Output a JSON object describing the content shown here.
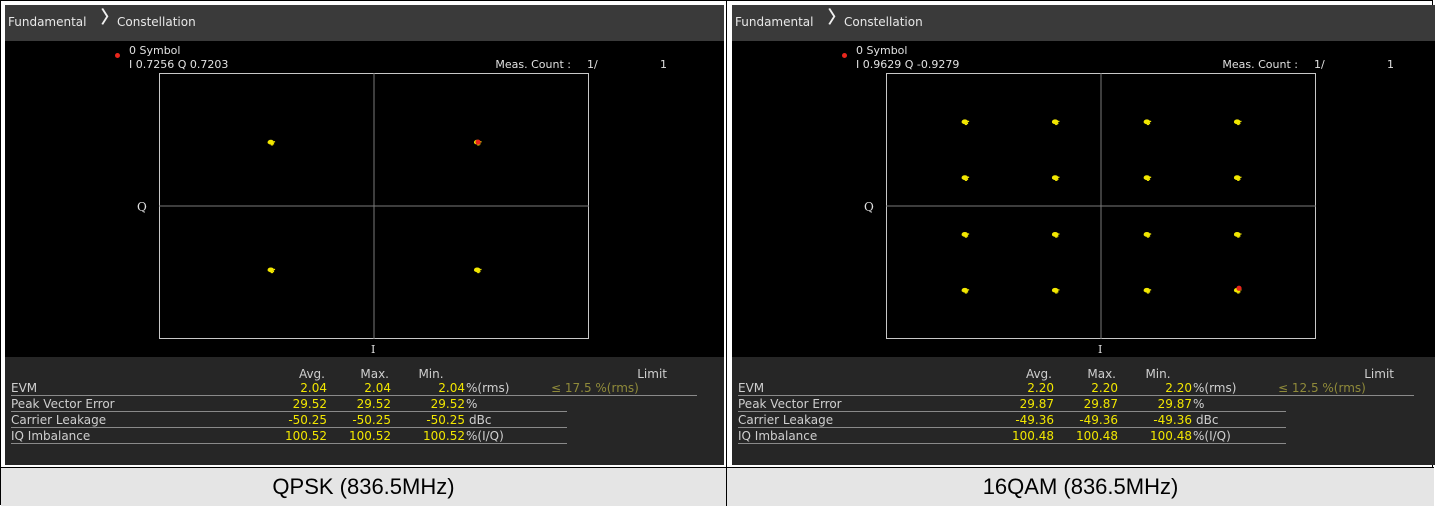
{
  "panels": [
    {
      "breadcrumb": [
        "Fundamental",
        "Constellation"
      ],
      "marker": {
        "title": "0 Symbol",
        "iq": "I 0.7256 Q 0.7203"
      },
      "meas_count": {
        "label": "Meas. Count :",
        "value": "1/",
        "total": "1"
      },
      "axes": {
        "x": "I",
        "y": "Q"
      },
      "modulation": "QPSK",
      "constellation": {
        "symbols": [
          [
            -0.72,
            0.72
          ],
          [
            0.72,
            0.72
          ],
          [
            -0.72,
            -0.72
          ],
          [
            0.72,
            -0.72
          ]
        ],
        "marker_symbol": [
          0.7256,
          0.7203
        ],
        "range": [
          -1.5,
          1.5
        ]
      },
      "results": {
        "headers": {
          "avg": "Avg.",
          "max": "Max.",
          "min": "Min.",
          "limit": "Limit"
        },
        "rows": [
          {
            "label": "EVM",
            "avg": "2.04",
            "max": "2.04",
            "min": "2.04",
            "unit": "%(rms)",
            "limit": "≤ 17.5 %(rms)"
          },
          {
            "label": "Peak Vector Error",
            "avg": "29.52",
            "max": "29.52",
            "min": "29.52",
            "unit": "%",
            "limit": ""
          },
          {
            "label": "Carrier Leakage",
            "avg": "-50.25",
            "max": "-50.25",
            "min": "-50.25",
            "unit": "dBc",
            "limit": ""
          },
          {
            "label": "IQ Imbalance",
            "avg": "100.52",
            "max": "100.52",
            "min": "100.52",
            "unit": "%(I/Q)",
            "limit": ""
          }
        ]
      },
      "caption": "QPSK (836.5MHz)"
    },
    {
      "breadcrumb": [
        "Fundamental",
        "Constellation"
      ],
      "marker": {
        "title": "0 Symbol",
        "iq": "I 0.9629 Q -0.9279"
      },
      "meas_count": {
        "label": "Meas. Count :",
        "value": "1/",
        "total": "1"
      },
      "axes": {
        "x": "I",
        "y": "Q"
      },
      "modulation": "16QAM",
      "constellation": {
        "symbols": [
          [
            -0.95,
            0.95
          ],
          [
            -0.32,
            0.95
          ],
          [
            0.32,
            0.95
          ],
          [
            0.95,
            0.95
          ],
          [
            -0.95,
            0.32
          ],
          [
            -0.32,
            0.32
          ],
          [
            0.32,
            0.32
          ],
          [
            0.95,
            0.32
          ],
          [
            -0.95,
            -0.32
          ],
          [
            -0.32,
            -0.32
          ],
          [
            0.32,
            -0.32
          ],
          [
            0.95,
            -0.32
          ],
          [
            -0.95,
            -0.95
          ],
          [
            -0.32,
            -0.95
          ],
          [
            0.32,
            -0.95
          ],
          [
            0.95,
            -0.95
          ]
        ],
        "marker_symbol": [
          0.9629,
          -0.9279
        ],
        "range": [
          -1.5,
          1.5
        ]
      },
      "results": {
        "headers": {
          "avg": "Avg.",
          "max": "Max.",
          "min": "Min.",
          "limit": "Limit"
        },
        "rows": [
          {
            "label": "EVM",
            "avg": "2.20",
            "max": "2.20",
            "min": "2.20",
            "unit": "%(rms)",
            "limit": "≤ 12.5 %(rms)"
          },
          {
            "label": "Peak Vector Error",
            "avg": "29.87",
            "max": "29.87",
            "min": "29.87",
            "unit": "%",
            "limit": ""
          },
          {
            "label": "Carrier Leakage",
            "avg": "-49.36",
            "max": "-49.36",
            "min": "-49.36",
            "unit": "dBc",
            "limit": ""
          },
          {
            "label": "IQ Imbalance",
            "avg": "100.48",
            "max": "100.48",
            "min": "100.48",
            "unit": "%(I/Q)",
            "limit": ""
          }
        ]
      },
      "caption": "16QAM (836.5MHz)"
    }
  ],
  "colors": {
    "symbol": "#f2e700",
    "marker": "#e8261c",
    "value_text": "#f2e700",
    "limit_text": "#8f8a3a",
    "caption_bg": "#e5e5e5"
  }
}
